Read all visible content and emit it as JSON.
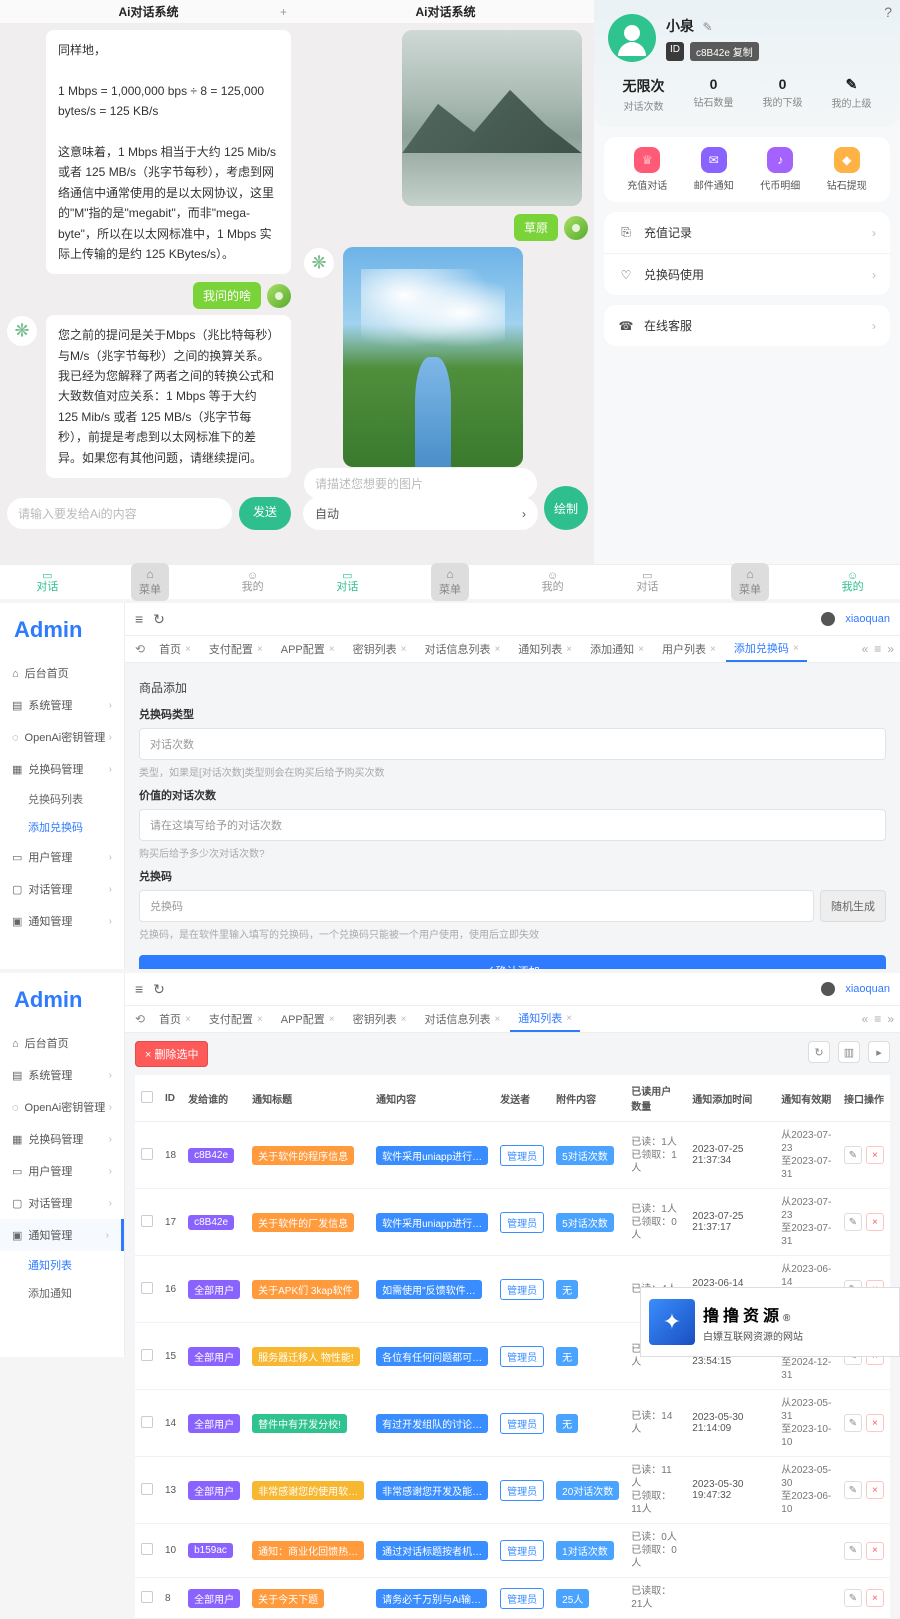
{
  "mobile": {
    "chat1": {
      "tab_title": "Ai对话系统",
      "bubble1_a": "同样地，",
      "bubble1_b": "1 Mbps = 1,000,000 bps ÷ 8 = 125,000 bytes/s = 125 KB/s",
      "bubble1_c": "这意味着，1 Mbps 相当于大约 125 Mib/s 或者 125 MB/s（兆字节每秒），考虑到网络通信中通常使用的是以太网协议，这里的\"M\"指的是\"megabit\"，而非\"mega-byte\"，所以在以太网标准中，1 Mbps 实际上传输的是约 125 KBytes/s）。",
      "user_msg": "我问的啥",
      "bubble2": "您之前的提问是关于Mbps（兆比特每秒）与M/s（兆字节每秒）之间的换算关系。我已经为您解释了两者之间的转换公式和大致数值对应关系：1 Mbps 等于大约 125 Mib/s 或者 125 MB/s（兆字节每秒），前提是考虑到以太网标准下的差异。如果您有其他问题，请继续提问。",
      "input_placeholder": "请输入要发给Ai的内容",
      "send": "发送"
    },
    "chat2": {
      "tab_title": "Ai对话系统",
      "tag1": "草原",
      "desc_placeholder": "请描述您想要的图片",
      "auto_label": "自动",
      "draw": "绘制"
    },
    "nav": {
      "talk": "对话",
      "mid": "菜单",
      "mine": "我的"
    },
    "profile": {
      "name": "小泉",
      "id_label": "ID",
      "id_code": "c8B42e 复制",
      "stats": [
        {
          "v": "无限次",
          "l": "对话次数"
        },
        {
          "v": "0",
          "l": "钻石数量"
        },
        {
          "v": "0",
          "l": "我的下级"
        },
        {
          "v": "✎",
          "l": "我的上级"
        }
      ],
      "quick": [
        {
          "icon": "♕",
          "label": "充值对话"
        },
        {
          "icon": "✉",
          "label": "邮件通知"
        },
        {
          "icon": "♪",
          "label": "代币明细"
        },
        {
          "icon": "◆",
          "label": "钻石提现"
        }
      ],
      "list1": [
        {
          "icon": "⎘",
          "label": "充值记录"
        },
        {
          "icon": "♡",
          "label": "兑换码使用"
        }
      ],
      "list2": [
        {
          "icon": "☎",
          "label": "在线客服"
        }
      ]
    }
  },
  "admin1": {
    "logo": "Admin",
    "user": "xiaoquan",
    "side": [
      {
        "icon": "⌂",
        "label": "后台首页"
      },
      {
        "icon": "▤",
        "label": "系统管理",
        "expand": true
      },
      {
        "icon": "◌",
        "label": "OpenAi密钥管理",
        "expand": true
      },
      {
        "icon": "▦",
        "label": "兑换码管理",
        "expand": true
      }
    ],
    "side_subs": [
      "兑换码列表",
      "添加兑换码"
    ],
    "side_after": [
      {
        "icon": "▭",
        "label": "用户管理",
        "expand": true
      },
      {
        "icon": "▢",
        "label": "对话管理",
        "expand": true
      },
      {
        "icon": "▣",
        "label": "通知管理",
        "expand": true
      }
    ],
    "tabs": [
      "首页",
      "支付配置",
      "APP配置",
      "密钥列表",
      "对话信息列表",
      "通知列表",
      "添加通知",
      "用户列表",
      "添加兑换码"
    ],
    "active_tab": "添加兑换码",
    "form": {
      "page_title": "商品添加",
      "f1_label": "兑换码类型",
      "f1_value": "对话次数",
      "f1_hint": "类型，如果是[对话次数]类型则会在购买后给予购买次数",
      "f2_label": "价值的对话次数",
      "f2_placeholder": "请在这填写给予的对话次数",
      "f2_hint": "购买后给予多少次对话次数?",
      "f3_label": "兑换码",
      "f3_placeholder": "兑换码",
      "f3_gen": "随机生成",
      "f3_hint": "兑换码，是在软件里输入填写的兑换码，一个兑换码只能被一个用户使用，使用后立即失效",
      "confirm": "✓ 确认添加"
    }
  },
  "admin2": {
    "logo": "Admin",
    "user": "xiaoquan",
    "side": [
      {
        "icon": "⌂",
        "label": "后台首页"
      },
      {
        "icon": "▤",
        "label": "系统管理",
        "expand": true
      },
      {
        "icon": "◌",
        "label": "OpenAi密钥管理",
        "expand": true
      },
      {
        "icon": "▦",
        "label": "兑换码管理",
        "expand": true
      },
      {
        "icon": "▭",
        "label": "用户管理",
        "expand": true
      },
      {
        "icon": "▢",
        "label": "对话管理",
        "expand": true
      },
      {
        "icon": "▣",
        "label": "通知管理",
        "expand": true
      }
    ],
    "side_subs": [
      "通知列表",
      "添加通知"
    ],
    "tabs": [
      "首页",
      "支付配置",
      "APP配置",
      "密钥列表",
      "对话信息列表",
      "通知列表"
    ],
    "active_tab": "通知列表",
    "del_sel": "× 删除选中",
    "columns": [
      "",
      "ID",
      "发给谁的",
      "通知标题",
      "通知内容",
      "发送者",
      "附件内容",
      "已读用户数量",
      "通知添加时间",
      "通知有效期",
      "接口操作"
    ],
    "rows": [
      {
        "id": "18",
        "who": "c8B42e",
        "who_c": "purple",
        "title": "关于软件的程序信息",
        "title_c": "orange",
        "content": "软件采用uniapp进行…",
        "sender": "管理员",
        "attach": "5对话次数",
        "attach_c": "ltblue",
        "read": "已读：1人\n已领取：1人",
        "time": "2023-07-25 21:37:34",
        "range": "从2023-07-23\n至2023-07-31"
      },
      {
        "id": "17",
        "who": "c8B42e",
        "who_c": "purple",
        "title": "关于软件的厂发信息",
        "title_c": "orange",
        "content": "软件采用uniapp进行…",
        "sender": "管理员",
        "attach": "5对话次数",
        "attach_c": "ltblue",
        "read": "已读：1人\n已领取：0人",
        "time": "2023-07-25 21:37:17",
        "range": "从2023-07-23\n至2023-07-31"
      },
      {
        "id": "16",
        "who": "全部用户",
        "who_c": "purple",
        "title": "关于APK们 3kap软件",
        "title_c": "orange",
        "content": "如需使用\"反馈软件…",
        "sender": "管理员",
        "attach": "无",
        "attach_c": "ltblue",
        "read": "已读：4人",
        "time": "2023-06-14 15:10:58",
        "range": "从2023-06-14\n至2023-06-30"
      },
      {
        "id": "15",
        "who": "全部用户",
        "who_c": "purple",
        "title": "服务器迁移人 物性能!",
        "title_c": "yellow",
        "content": "各位有任何问题都可…",
        "sender": "管理员",
        "attach": "无",
        "attach_c": "ltblue",
        "read": "已读：12人",
        "time": "2023-05-31 23:54:15",
        "range": "从2023-05-31\n至2024-12-31"
      },
      {
        "id": "14",
        "who": "全部用户",
        "who_c": "purple",
        "title": "替件中有开发分校!",
        "title_c": "green",
        "content": "有过开发组队的讨论…",
        "sender": "管理员",
        "attach": "无",
        "attach_c": "ltblue",
        "read": "已读：14人",
        "time": "2023-05-30 21:14:09",
        "range": "从2023-05-31\n至2023-10-10"
      },
      {
        "id": "13",
        "who": "全部用户",
        "who_c": "purple",
        "title": "非常感谢您的使用软…",
        "title_c": "yellow",
        "content": "非常感谢您开发及能…",
        "sender": "管理员",
        "attach": "20对话次数",
        "attach_c": "ltblue",
        "read": "已读：11人\n已领取：11人",
        "time": "2023-05-30 19:47:32",
        "range": "从2023-05-30\n至2023-06-10"
      },
      {
        "id": "10",
        "who": "b159ac",
        "who_c": "purple",
        "title": "通知：商业化回馈热…",
        "title_c": "orange",
        "content": "通过对话标题按者机…",
        "sender": "管理员",
        "attach": "1对话次数",
        "attach_c": "ltblue",
        "read": "已读：0人\n已领取：0人",
        "time": "",
        "range": ""
      },
      {
        "id": "8",
        "who": "全部用户",
        "who_c": "purple",
        "title": "关于今天下题",
        "title_c": "orange",
        "content": "请务必千万别与Ai输…",
        "sender": "管理员",
        "attach": "25人",
        "attach_c": "ltblue",
        "read": "已读取：21人",
        "time": "",
        "range": ""
      }
    ],
    "watermark": {
      "t1": "撸撸资源",
      "t2": "白嫖互联网资源的网站",
      "reg": "®"
    }
  }
}
